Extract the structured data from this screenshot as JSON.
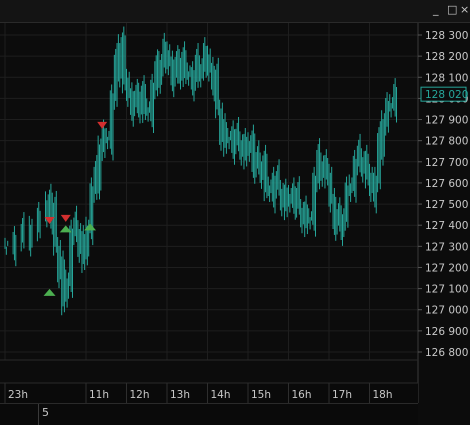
{
  "window_controls": {
    "minimize": "_",
    "maximize": "□",
    "close": "×"
  },
  "colors": {
    "background": "#0c0c0c",
    "grid": "#1e1e1e",
    "axis_text": "#c8c8c8",
    "bars": "#26a69a",
    "sell_marker": "#d32f2f",
    "buy_marker": "#4caf50",
    "last_price_box": "#26a69a"
  },
  "date_row": {
    "label": "5"
  },
  "chart_data": {
    "type": "line",
    "style": "ohlc-bars",
    "y_ticks": [
      126800,
      126900,
      127000,
      127100,
      127200,
      127300,
      127400,
      127500,
      127600,
      127700,
      127800,
      127900,
      128000,
      128100,
      128200,
      128300
    ],
    "y_tick_labels": [
      "126 800",
      "126 900",
      "127 000",
      "127 100",
      "127 200",
      "127 300",
      "127 400",
      "127 500",
      "127 600",
      "127 700",
      "127 800",
      "127 900",
      "128 000",
      "128 100",
      "128 200",
      "128 300"
    ],
    "ylim": [
      126800,
      128300
    ],
    "last_price": 128020,
    "last_price_label": "128 020",
    "x_ticks": [
      "23h",
      "11h",
      "12h",
      "13h",
      "14h",
      "15h",
      "16h",
      "17h",
      "18h"
    ],
    "xlim": [
      0,
      100
    ],
    "x_tick_positions": [
      0,
      20,
      30,
      40,
      50,
      60,
      70,
      80,
      90
    ],
    "x": [
      0,
      2,
      4,
      6,
      8,
      10,
      11,
      12,
      13,
      14,
      15,
      16,
      17,
      18,
      19,
      20,
      21,
      22,
      23,
      24,
      25,
      26,
      27,
      28,
      29,
      30,
      31,
      32,
      33,
      34,
      35,
      36,
      37,
      38,
      39,
      40,
      41,
      42,
      43,
      44,
      45,
      46,
      47,
      48,
      49,
      50,
      51,
      52,
      53,
      54,
      55,
      56,
      57,
      58,
      59,
      60,
      61,
      62,
      63,
      64,
      65,
      66,
      67,
      68,
      69,
      70,
      71,
      72,
      73,
      74,
      75,
      76,
      77,
      78,
      79,
      80,
      81,
      82,
      83,
      84,
      85,
      86,
      87,
      88,
      89,
      90,
      91,
      92,
      93,
      94,
      95,
      96
    ],
    "series": [
      {
        "values": [
          127300,
          127320,
          127350,
          127400,
          127430,
          127520,
          127450,
          127300,
          127200,
          127050,
          127150,
          127350,
          127380,
          127320,
          127250,
          127400,
          127550,
          127620,
          127780,
          127820,
          127800,
          127990,
          128150,
          128260,
          128100,
          128000,
          127960,
          127980,
          128030,
          127960,
          127930,
          128040,
          128120,
          128180,
          128230,
          128150,
          128100,
          128140,
          128190,
          128130,
          128100,
          128080,
          128150,
          128160,
          128210,
          128120,
          128080,
          127950,
          127850,
          127800,
          127820,
          127780,
          127800,
          127780,
          127740,
          127800,
          127690,
          127670,
          127700,
          127590,
          127550,
          127600,
          127570,
          127540,
          127500,
          127550,
          127520,
          127480,
          127460,
          127420,
          127440,
          127600,
          127700,
          127680,
          127650,
          127500,
          127420,
          127400,
          127450,
          127550,
          127600,
          127680,
          127720,
          127700,
          127650,
          127550,
          127600,
          127780,
          127900,
          127950,
          127980,
          128020
        ]
      }
    ],
    "sell_markers": [
      {
        "x": 11,
        "y": 127420
      },
      {
        "x": 15,
        "y": 127430
      },
      {
        "x": 24,
        "y": 127870
      }
    ],
    "buy_markers": [
      {
        "x": 11,
        "y": 127080
      },
      {
        "x": 15,
        "y": 127380
      },
      {
        "x": 21,
        "y": 127390
      }
    ],
    "grid": true,
    "legend": "none"
  }
}
